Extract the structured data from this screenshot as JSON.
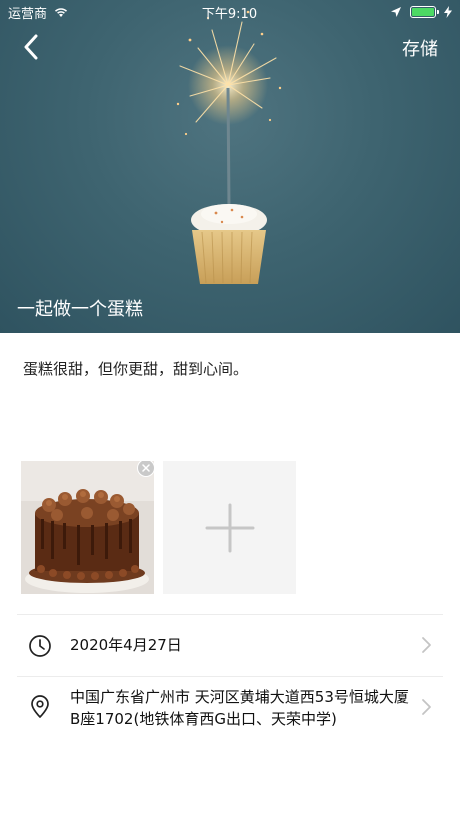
{
  "status_bar": {
    "carrier": "运营商",
    "time": "下午9:10"
  },
  "header": {
    "save_label": "存储",
    "title": "一起做一个蛋糕"
  },
  "content": {
    "description": "蛋糕很甜，但你更甜，甜到心间。"
  },
  "details": {
    "date": "2020年4月27日",
    "address": "中国广东省广州市 天河区黄埔大道西53号恒城大厦B座1702(地铁体育西G出口、天荣中学)"
  },
  "colors": {
    "battery": "#4cd964",
    "hero_background": "#3e6470",
    "add_tile": "#f4f4f4"
  },
  "icons": [
    "back-icon",
    "wifi-icon",
    "location-arrow-icon",
    "battery-icon",
    "close-icon",
    "plus-icon",
    "clock-icon",
    "location-pin-icon",
    "chevron-right-icon"
  ]
}
